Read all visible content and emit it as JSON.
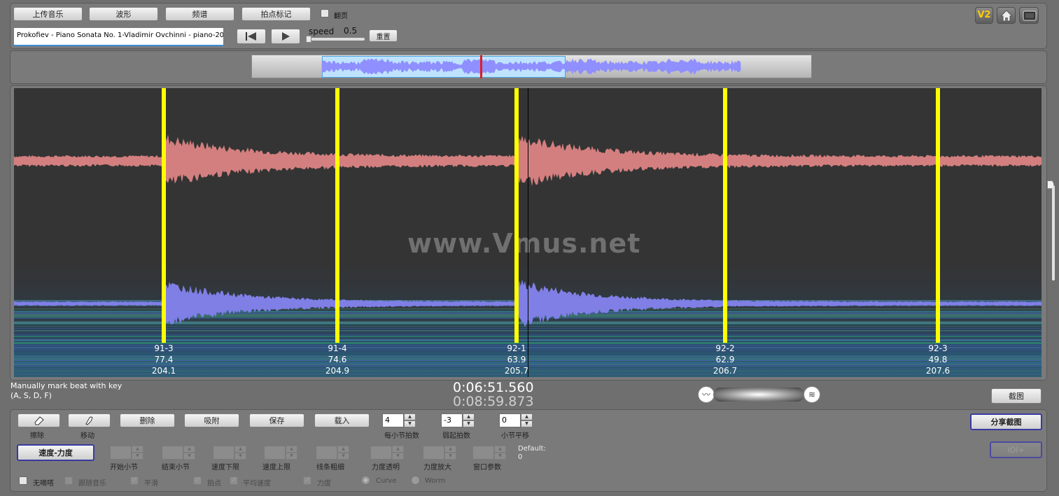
{
  "toolbar": {
    "upload": "上传音乐",
    "waveform": "波形",
    "spectrum": "频谱",
    "beat_mark": "拍点标记",
    "flip_page": "翻页",
    "track_name": "Prokofiev - Piano Sonata No. 1-Vladimir Ovchinni - piano-20",
    "speed_label": "speed",
    "speed_value": "0.5",
    "reset": "重置"
  },
  "top_icons": {
    "v2": "V2"
  },
  "watermark": "www.Vmus.net",
  "beats": [
    {
      "label": "91-3",
      "tempo": "77.4",
      "time": "204.1"
    },
    {
      "label": "91-4",
      "tempo": "74.6",
      "time": "204.9"
    },
    {
      "label": "92-1",
      "tempo": "63.9",
      "time": "205.7"
    },
    {
      "label": "92-2",
      "tempo": "62.9",
      "time": "206.7"
    },
    {
      "label": "92-3",
      "tempo": "49.8",
      "time": "207.6"
    }
  ],
  "status": {
    "hint_line1": "Manually mark beat with key",
    "hint_line2": "(A, S, D, F)",
    "current_time": "0:06:51.560",
    "total_time": "0:08:59.873",
    "screenshot": "截图"
  },
  "controls": {
    "erase": "擦除",
    "move": "移动",
    "delete": "删除",
    "snap": "吸附",
    "save": "保存",
    "load": "载入",
    "beats_per_bar_value": "4",
    "beats_per_bar_label": "每小节拍数",
    "pickup_value": "-3",
    "pickup_label": "弱起拍数",
    "bar_shift_value": "0",
    "bar_shift_label": "小节平移",
    "share_screenshot": "分享截图",
    "ioi": "IOI+",
    "tempo_dynamics": "速度-力度",
    "start_bar": "开始小节",
    "end_bar": "结束小节",
    "tempo_low": "速度下限",
    "tempo_high": "速度上限",
    "line_width": "线条粗细",
    "dyn_opacity": "力度透明",
    "dyn_zoom": "力度放大",
    "window_param": "窗口参数",
    "default_label": "Default:",
    "default_value": "0",
    "no_beat": "无嘀嗒",
    "follow_music": "跟随音乐",
    "smooth": "平滑",
    "beat": "拍点",
    "avg_tempo": "平均速度",
    "dynamics": "力度",
    "curve": "Curve",
    "worm": "Worm"
  },
  "colors": {
    "beat_line": "#ffff00",
    "upper_wave": "#d47f7f",
    "lower_wave": "#7f7fe6",
    "overview_wave": "#8f8fff"
  }
}
